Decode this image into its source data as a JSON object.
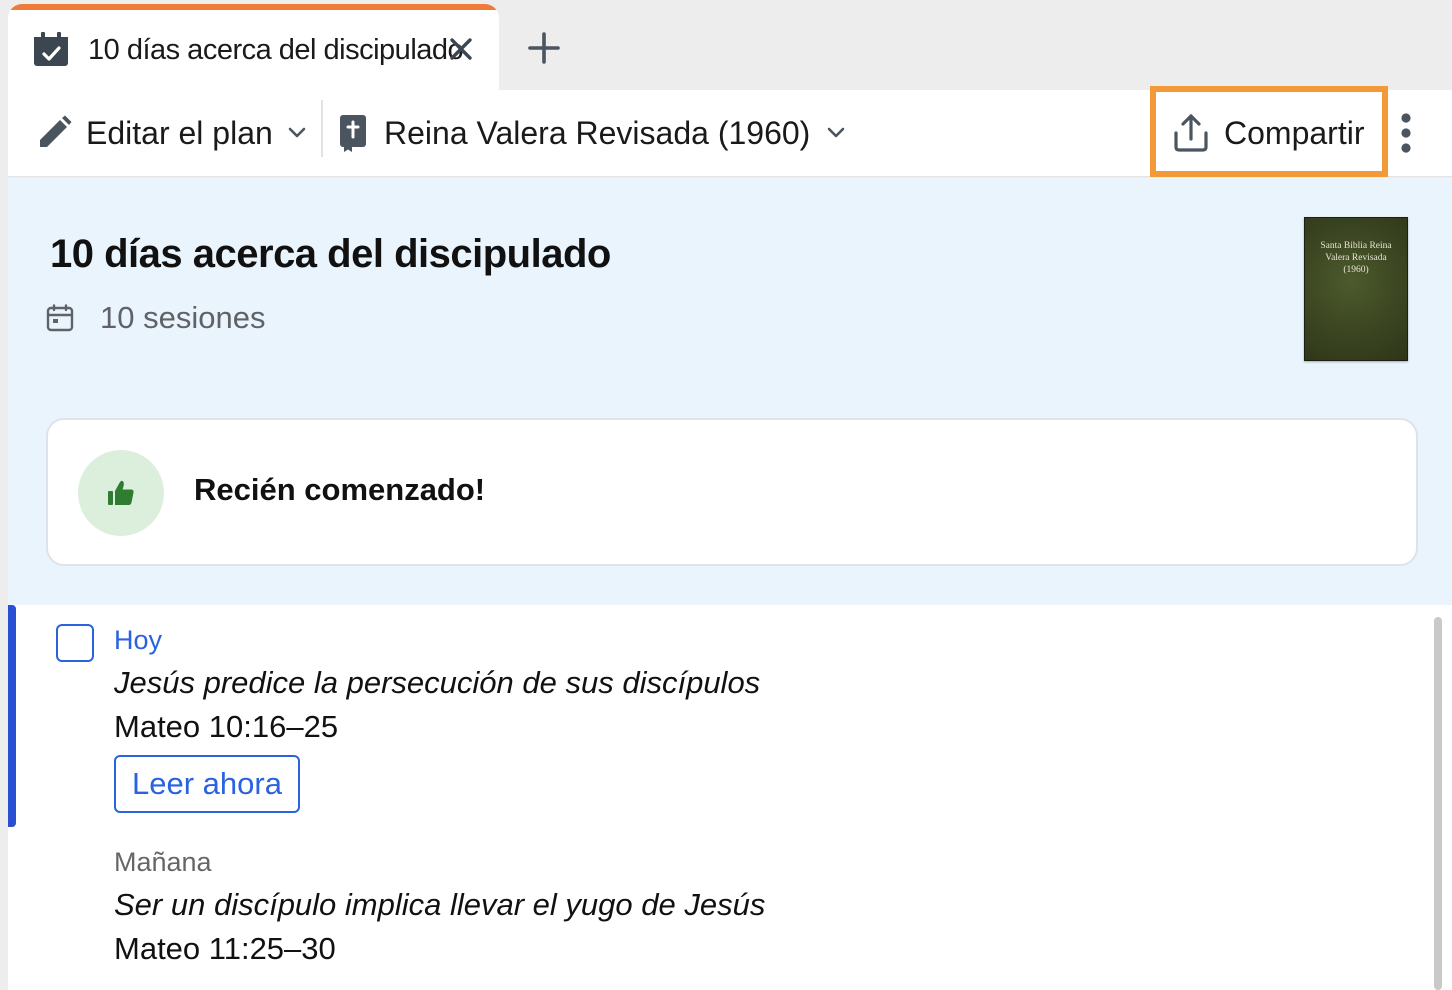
{
  "tab": {
    "title": "10 días acerca del discipulado",
    "icon": "calendar-check-icon",
    "close_icon": "close-icon",
    "new_tab_icon": "plus-icon",
    "accent_color": "#f07a3a"
  },
  "toolbar": {
    "edit_plan_label": "Editar el plan",
    "bible_version_label": "Reina Valera Revisada (1960)",
    "share_label": "Compartir",
    "share_highlight_color": "#f29a38"
  },
  "plan": {
    "title": "10 días acerca del discipulado",
    "sessions_label": "10 sesiones",
    "cover_text": "Santa Biblia Reina Valera Revisada (1960)"
  },
  "progress": {
    "status": "Recién comenzado!",
    "icon": "thumbs-up-icon"
  },
  "readings": [
    {
      "day": "Hoy",
      "title": "Jesús predice la persecución de sus discípulos",
      "reference": "Mateo 10:16–25",
      "action": "Leer ahora",
      "checked": false
    },
    {
      "day": "Mañana",
      "title": "Ser un discípulo implica llevar el yugo de Jesús",
      "reference": "Mateo 11:25–30"
    }
  ],
  "colors": {
    "link_blue": "#2a62e0",
    "today_bar": "#2a4fd1",
    "header_bg": "#eaf4fd",
    "progress_icon_bg": "#dcefdc",
    "progress_icon": "#2e7d32"
  }
}
